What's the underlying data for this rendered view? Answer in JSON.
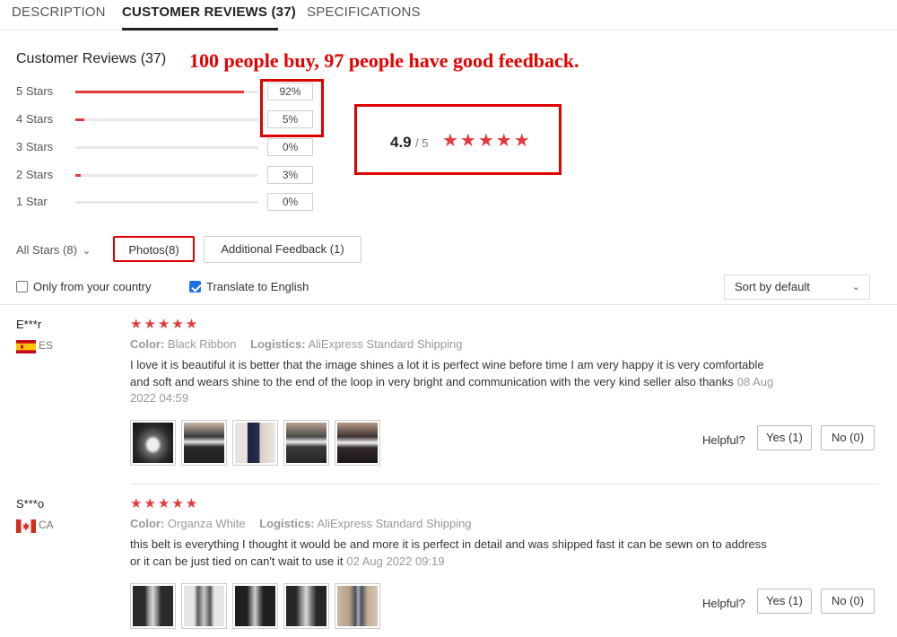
{
  "tabs": [
    {
      "label": "DESCRIPTION"
    },
    {
      "label": "CUSTOMER REVIEWS (37)"
    },
    {
      "label": "SPECIFICATIONS"
    }
  ],
  "summary": {
    "title": "Customer Reviews (37)",
    "promo_text": "100 people buy, 97 people have good feedback.",
    "distribution": [
      {
        "label": "5 Stars",
        "percent_text": "92%",
        "fraction": 0.92
      },
      {
        "label": "4 Stars",
        "percent_text": "5%",
        "fraction": 0.05
      },
      {
        "label": "3 Stars",
        "percent_text": "0%",
        "fraction": 0.0
      },
      {
        "label": "2 Stars",
        "percent_text": "3%",
        "fraction": 0.03
      },
      {
        "label": "1 Star",
        "percent_text": "0%",
        "fraction": 0.0
      }
    ],
    "average_score": "4.9",
    "average_denominator": "/ 5",
    "average_stars": "★★★★★"
  },
  "filters": {
    "all_stars": "All Stars (8)",
    "photos": "Photos(8)",
    "additional_feedback": "Additional Feedback (1)",
    "only_country": "Only from your country",
    "only_country_checked": false,
    "translate": "Translate to English",
    "translate_checked": true,
    "sort_value": "Sort by default"
  },
  "reviews": [
    {
      "name": "E***r",
      "country": "ES",
      "stars": "★★★★★",
      "color_label": "Color:",
      "color_value": "Black Ribbon",
      "logistics_label": "Logistics:",
      "logistics_value": "AliExpress Standard Shipping",
      "text": "I love it is beautiful it is better that the image shines a lot it is perfect wine before time I am very happy it is very comfortable and soft and wears shine to the end of the loop in very bright and communication with the very kind seller also thanks",
      "date": "08 Aug 2022 04:59",
      "helpful_label": "Helpful?",
      "yes_label": "Yes (1)",
      "no_label": "No (0)"
    },
    {
      "name": "S***o",
      "country": "CA",
      "stars": "★★★★★",
      "color_label": "Color:",
      "color_value": "Organza White",
      "logistics_label": "Logistics:",
      "logistics_value": "AliExpress Standard Shipping",
      "text": "this belt is everything I thought it would be and more it is perfect in detail and was shipped fast it can be sewn on to address or it can be just tied on can't wait to use it",
      "date": "02 Aug 2022 09:19",
      "helpful_label": "Helpful?",
      "yes_label": "Yes (1)",
      "no_label": "No (0)"
    }
  ],
  "colors": {
    "accent_red": "#e4393c",
    "highlight_red": "#e00000",
    "checkbox_blue": "#1a73e8"
  },
  "icons": {
    "dropdown": "chevron-down-icon",
    "star": "star-icon",
    "flag_es": "spain-flag-icon",
    "flag_ca": "canada-flag-icon"
  }
}
